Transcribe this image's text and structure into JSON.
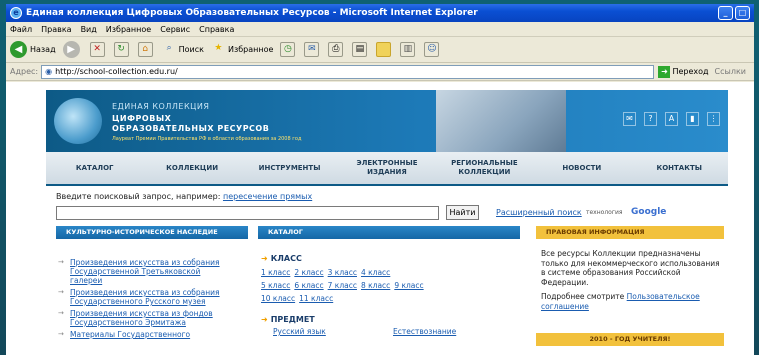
{
  "window": {
    "title": "Единая коллекция Цифровых Образовательных Ресурсов - Microsoft Internet Explorer"
  },
  "menu": [
    "Файл",
    "Правка",
    "Вид",
    "Избранное",
    "Сервис",
    "Справка"
  ],
  "toolbar": {
    "back": "Назад",
    "search": "Поиск",
    "favorites": "Избранное"
  },
  "address": {
    "label": "Адрес:",
    "url": "http://school-collection.edu.ru/",
    "go": "Переход",
    "links": "Ссылки"
  },
  "banner": {
    "line1": "ЕДИНАЯ КОЛЛЕКЦИЯ",
    "line2": "ЦИФРОВЫХ",
    "line3": "ОБРАЗОВАТЕЛЬНЫХ РЕСУРСОВ",
    "award": "Лауреат Премии Правительства РФ в области образования за 2008 год"
  },
  "nav": [
    "КАТАЛОГ",
    "КОЛЛЕКЦИИ",
    "ИНСТРУМЕНТЫ",
    "ЭЛЕКТРОННЫЕ ИЗДАНИЯ",
    "РЕГИОНАЛЬНЫЕ КОЛЛЕКЦИИ",
    "НОВОСТИ",
    "КОНТАКТЫ"
  ],
  "search": {
    "hint": "Введите поисковый запрос, например:",
    "example": "пересечение прямых",
    "button": "Найти",
    "advanced": "Расширенный поиск",
    "tech": "технология",
    "google": "Google"
  },
  "left": {
    "heading": "КУЛЬТУРНО-ИСТОРИЧЕСКОЕ НАСЛЕДИЕ",
    "links": [
      "Произведения искусства из собрания Государственной Третьяковской галереи",
      "Произведения искусства из собрания Государственного Русского музея",
      "Произведения искусства из фондов Государственного Эрмитажа",
      "Материалы Государственного"
    ]
  },
  "catalog": {
    "heading": "КАТАЛОГ",
    "class_title": "КЛАСС",
    "grades": [
      "1 класс",
      "2 класс",
      "3 класс",
      "4 класс",
      "5 класс",
      "6 класс",
      "7 класс",
      "8 класс",
      "9 класс",
      "10 класс",
      "11 класс"
    ],
    "subject_title": "ПРЕДМЕТ",
    "subjects": [
      "Русский язык",
      "Естествознание"
    ]
  },
  "right": {
    "heading": "ПРАВОВАЯ ИНФОРМАЦИЯ",
    "text": "Все ресурсы Коллекции предназначены только для некоммерческого использования в системе образования Российской Федерации.",
    "more": "Подробнее смотрите",
    "link": "Пользовательское соглашение",
    "year_heading": "2010 - ГОД УЧИТЕЛЯ!"
  }
}
